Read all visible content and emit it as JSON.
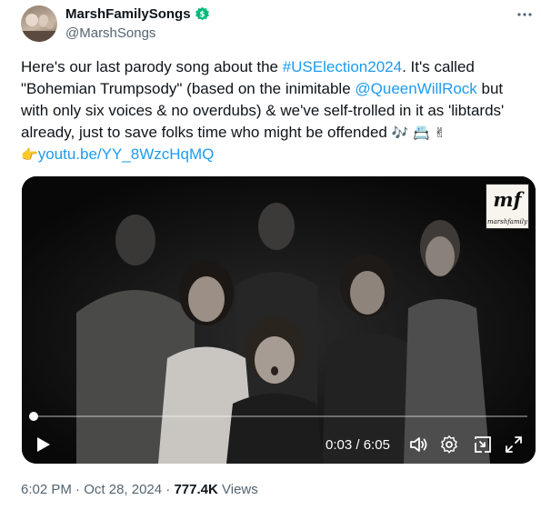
{
  "author": {
    "display_name": "MarshFamilySongs",
    "handle": "@MarshSongs",
    "badge_color": "#00ba7c",
    "badge_icon": "money-badge-icon"
  },
  "tweet": {
    "t1": "Here's our last parody song about the ",
    "hashtag": "#USElection2024",
    "t2": ". It's called \"Bohemian Trumpsody\" (based on the inimitable ",
    "mention": "@QueenWillRock",
    "t3": " but with only six voices & no overdubs) & we've self-trolled in it as 'libtards' already, just to save folks time who might be offended ",
    "emojis": "🎶 📇 ✌",
    "pointer": "👉",
    "link": "youtu.be/YY_8WzcHqMQ"
  },
  "video": {
    "logo_mark": "mf",
    "logo_text": "marshfamily",
    "current_time": "0:03",
    "separator": " / ",
    "duration": "6:05",
    "progress": 0.008,
    "controls": [
      "play-icon",
      "volume-icon",
      "settings-icon",
      "picture-in-picture-icon",
      "fullscreen-icon"
    ]
  },
  "meta": {
    "time": "6:02 PM",
    "dot1": " · ",
    "date": "Oct 28, 2024",
    "dot2": " · ",
    "views": "777.4K",
    "views_label": " Views"
  },
  "colors": {
    "link": "#1d9bf0",
    "text": "#0f1419",
    "secondary": "#536471"
  }
}
